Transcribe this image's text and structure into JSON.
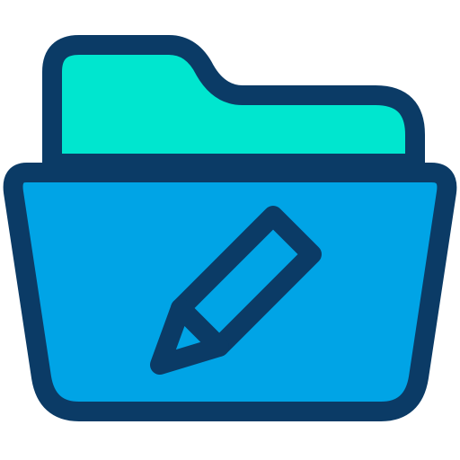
{
  "icon": {
    "name": "edit-folder-icon",
    "colors": {
      "outline": "#0B3B66",
      "folder_back": "#00E6CF",
      "folder_front": "#00A4E6",
      "background": "#FFFFFF"
    }
  }
}
